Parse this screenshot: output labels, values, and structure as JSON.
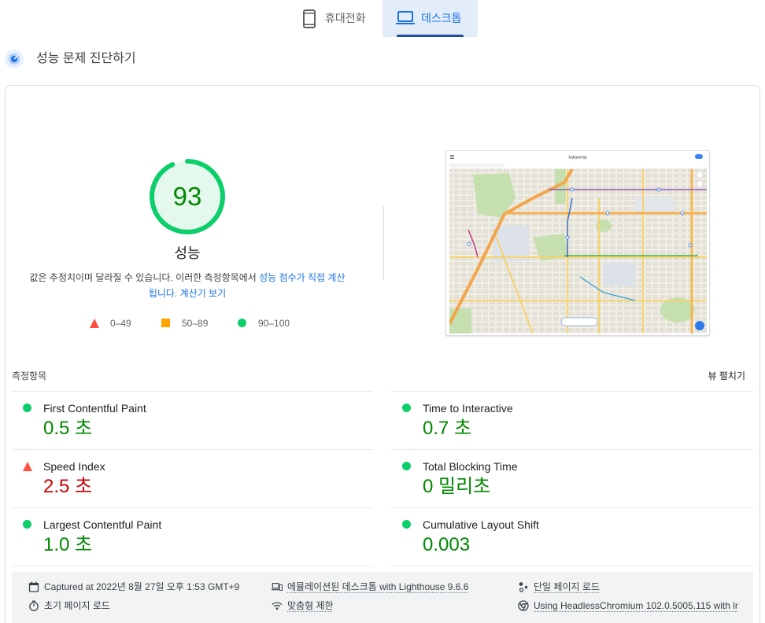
{
  "tabs": [
    {
      "label": "휴대전화",
      "icon": "smartphone-icon",
      "selected": false
    },
    {
      "label": "데스크톱",
      "icon": "laptop-icon",
      "selected": true
    }
  ],
  "section": {
    "title": "성능 문제 진단하기",
    "icon": "performance-gauge-icon"
  },
  "score": {
    "value": 93,
    "display": "93",
    "label": "성능",
    "description": "값은 추정치이며 달라질 수 있습니다. 이러한 측정항목에서 ",
    "score_link": "성능 점수가 직접 계산됩니다.",
    "calculator_link": "계산기 보기"
  },
  "legend": [
    {
      "shape": "triangle",
      "range": "0–49",
      "status": "fail"
    },
    {
      "shape": "square",
      "range": "50–89",
      "status": "average"
    },
    {
      "shape": "circle",
      "range": "90–100",
      "status": "pass"
    }
  ],
  "thumbnail": {
    "logo_text": "kakaomap"
  },
  "metrics": {
    "header": "측정항목",
    "expand_label": "뷰 펼치기",
    "items": [
      {
        "name": "First Contentful Paint",
        "value": "0.5 초",
        "status": "pass"
      },
      {
        "name": "Time to Interactive",
        "value": "0.7 초",
        "status": "pass"
      },
      {
        "name": "Speed Index",
        "value": "2.5 초",
        "status": "fail"
      },
      {
        "name": "Total Blocking Time",
        "value": "0 밀리초",
        "status": "pass"
      },
      {
        "name": "Largest Contentful Paint",
        "value": "1.0 초",
        "status": "pass"
      },
      {
        "name": "Cumulative Layout Shift",
        "value": "0.003",
        "status": "pass"
      }
    ]
  },
  "footer": {
    "items": [
      {
        "icon": "calendar-icon",
        "text": "Captured at 2022년 8월 27일 오후 1:53 GMT+9"
      },
      {
        "icon": "timer-icon",
        "text": "초기 페이지 로드"
      },
      {
        "icon": "devices-icon",
        "text": "에뮬레이션된 데스크톱 with Lighthouse 9.6.6"
      },
      {
        "icon": "wifi-icon",
        "text": "맞춤형 제한"
      },
      {
        "icon": "single-page-load-icon",
        "text": "단일 페이지 로드"
      },
      {
        "icon": "chrome-icon",
        "text": "Using HeadlessChromium 102.0.5005.115 with lr"
      }
    ]
  },
  "colors": {
    "pass": "#0cce6b",
    "pass_text": "#008800",
    "pass_fill": "#e5f8ed",
    "average": "#ffa400",
    "fail": "#ff4e42",
    "fail_text": "#cc0000",
    "accent": "#1a73e8"
  }
}
